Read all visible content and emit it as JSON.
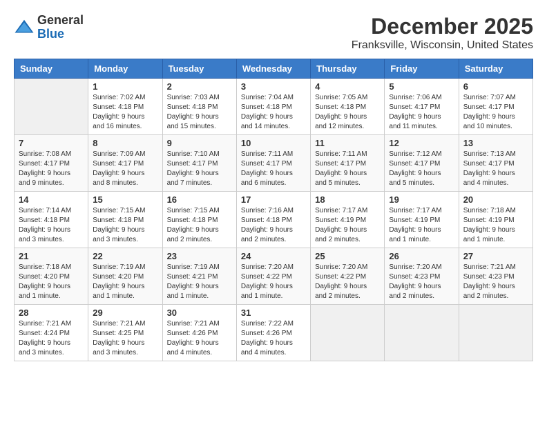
{
  "logo": {
    "general": "General",
    "blue": "Blue"
  },
  "title": "December 2025",
  "subtitle": "Franksville, Wisconsin, United States",
  "days_of_week": [
    "Sunday",
    "Monday",
    "Tuesday",
    "Wednesday",
    "Thursday",
    "Friday",
    "Saturday"
  ],
  "weeks": [
    [
      {
        "day": "",
        "info": ""
      },
      {
        "day": "1",
        "info": "Sunrise: 7:02 AM\nSunset: 4:18 PM\nDaylight: 9 hours\nand 16 minutes."
      },
      {
        "day": "2",
        "info": "Sunrise: 7:03 AM\nSunset: 4:18 PM\nDaylight: 9 hours\nand 15 minutes."
      },
      {
        "day": "3",
        "info": "Sunrise: 7:04 AM\nSunset: 4:18 PM\nDaylight: 9 hours\nand 14 minutes."
      },
      {
        "day": "4",
        "info": "Sunrise: 7:05 AM\nSunset: 4:18 PM\nDaylight: 9 hours\nand 12 minutes."
      },
      {
        "day": "5",
        "info": "Sunrise: 7:06 AM\nSunset: 4:17 PM\nDaylight: 9 hours\nand 11 minutes."
      },
      {
        "day": "6",
        "info": "Sunrise: 7:07 AM\nSunset: 4:17 PM\nDaylight: 9 hours\nand 10 minutes."
      }
    ],
    [
      {
        "day": "7",
        "info": "Sunrise: 7:08 AM\nSunset: 4:17 PM\nDaylight: 9 hours\nand 9 minutes."
      },
      {
        "day": "8",
        "info": "Sunrise: 7:09 AM\nSunset: 4:17 PM\nDaylight: 9 hours\nand 8 minutes."
      },
      {
        "day": "9",
        "info": "Sunrise: 7:10 AM\nSunset: 4:17 PM\nDaylight: 9 hours\nand 7 minutes."
      },
      {
        "day": "10",
        "info": "Sunrise: 7:11 AM\nSunset: 4:17 PM\nDaylight: 9 hours\nand 6 minutes."
      },
      {
        "day": "11",
        "info": "Sunrise: 7:11 AM\nSunset: 4:17 PM\nDaylight: 9 hours\nand 5 minutes."
      },
      {
        "day": "12",
        "info": "Sunrise: 7:12 AM\nSunset: 4:17 PM\nDaylight: 9 hours\nand 5 minutes."
      },
      {
        "day": "13",
        "info": "Sunrise: 7:13 AM\nSunset: 4:17 PM\nDaylight: 9 hours\nand 4 minutes."
      }
    ],
    [
      {
        "day": "14",
        "info": "Sunrise: 7:14 AM\nSunset: 4:18 PM\nDaylight: 9 hours\nand 3 minutes."
      },
      {
        "day": "15",
        "info": "Sunrise: 7:15 AM\nSunset: 4:18 PM\nDaylight: 9 hours\nand 3 minutes."
      },
      {
        "day": "16",
        "info": "Sunrise: 7:15 AM\nSunset: 4:18 PM\nDaylight: 9 hours\nand 2 minutes."
      },
      {
        "day": "17",
        "info": "Sunrise: 7:16 AM\nSunset: 4:18 PM\nDaylight: 9 hours\nand 2 minutes."
      },
      {
        "day": "18",
        "info": "Sunrise: 7:17 AM\nSunset: 4:19 PM\nDaylight: 9 hours\nand 2 minutes."
      },
      {
        "day": "19",
        "info": "Sunrise: 7:17 AM\nSunset: 4:19 PM\nDaylight: 9 hours\nand 1 minute."
      },
      {
        "day": "20",
        "info": "Sunrise: 7:18 AM\nSunset: 4:19 PM\nDaylight: 9 hours\nand 1 minute."
      }
    ],
    [
      {
        "day": "21",
        "info": "Sunrise: 7:18 AM\nSunset: 4:20 PM\nDaylight: 9 hours\nand 1 minute."
      },
      {
        "day": "22",
        "info": "Sunrise: 7:19 AM\nSunset: 4:20 PM\nDaylight: 9 hours\nand 1 minute."
      },
      {
        "day": "23",
        "info": "Sunrise: 7:19 AM\nSunset: 4:21 PM\nDaylight: 9 hours\nand 1 minute."
      },
      {
        "day": "24",
        "info": "Sunrise: 7:20 AM\nSunset: 4:22 PM\nDaylight: 9 hours\nand 1 minute."
      },
      {
        "day": "25",
        "info": "Sunrise: 7:20 AM\nSunset: 4:22 PM\nDaylight: 9 hours\nand 2 minutes."
      },
      {
        "day": "26",
        "info": "Sunrise: 7:20 AM\nSunset: 4:23 PM\nDaylight: 9 hours\nand 2 minutes."
      },
      {
        "day": "27",
        "info": "Sunrise: 7:21 AM\nSunset: 4:23 PM\nDaylight: 9 hours\nand 2 minutes."
      }
    ],
    [
      {
        "day": "28",
        "info": "Sunrise: 7:21 AM\nSunset: 4:24 PM\nDaylight: 9 hours\nand 3 minutes."
      },
      {
        "day": "29",
        "info": "Sunrise: 7:21 AM\nSunset: 4:25 PM\nDaylight: 9 hours\nand 3 minutes."
      },
      {
        "day": "30",
        "info": "Sunrise: 7:21 AM\nSunset: 4:26 PM\nDaylight: 9 hours\nand 4 minutes."
      },
      {
        "day": "31",
        "info": "Sunrise: 7:22 AM\nSunset: 4:26 PM\nDaylight: 9 hours\nand 4 minutes."
      },
      {
        "day": "",
        "info": ""
      },
      {
        "day": "",
        "info": ""
      },
      {
        "day": "",
        "info": ""
      }
    ]
  ]
}
